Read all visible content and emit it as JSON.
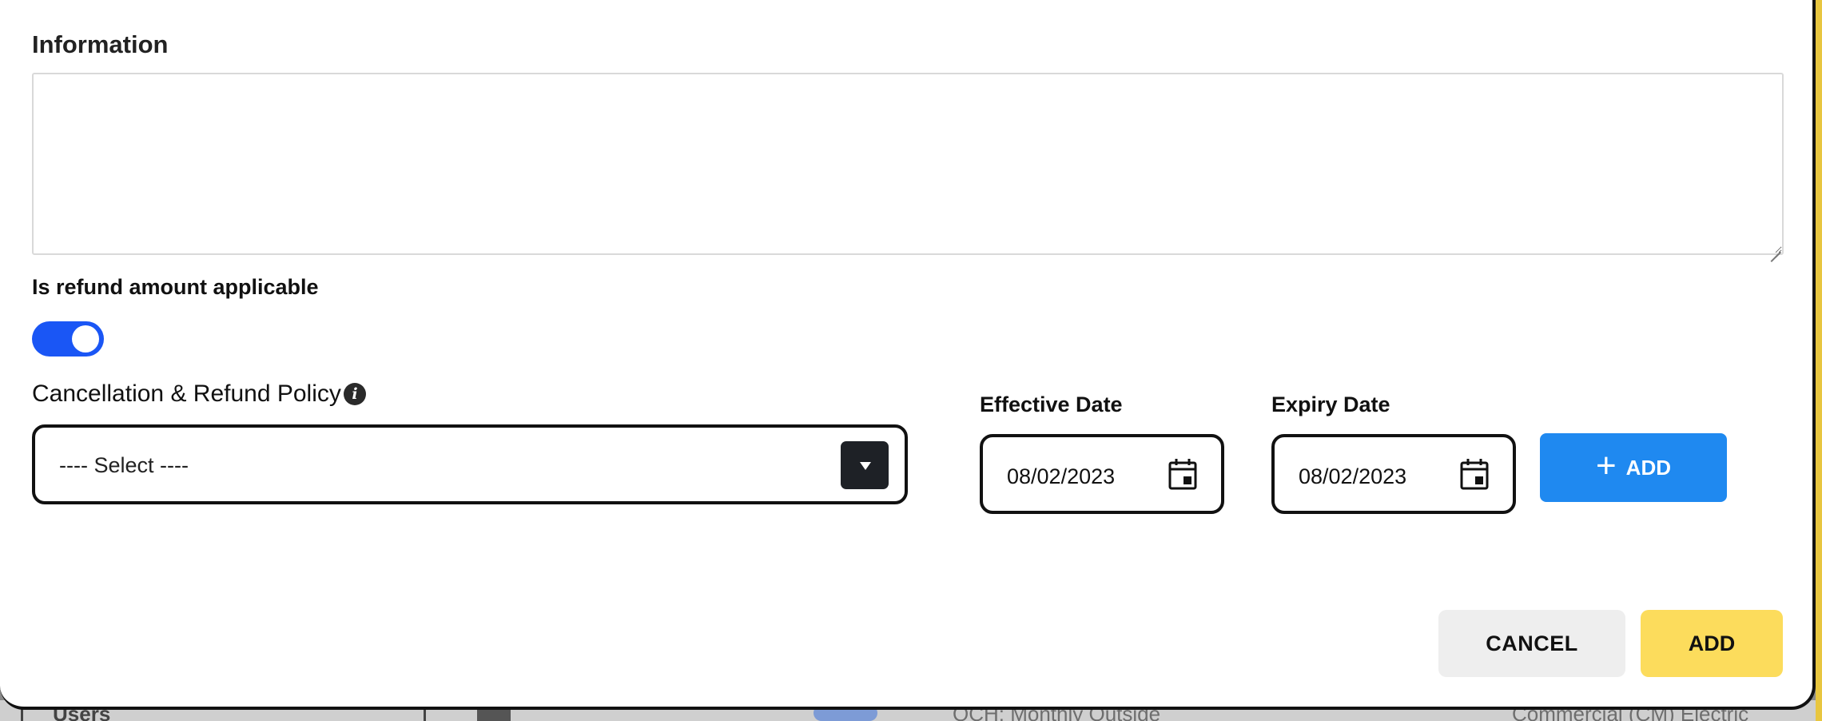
{
  "information": {
    "label": "Information",
    "value": ""
  },
  "refund": {
    "label": "Is refund amount applicable",
    "enabled": true
  },
  "policy": {
    "label": "Cancellation & Refund Policy",
    "info_icon": "info-circle-icon",
    "selected": "---- Select ----"
  },
  "effective_date": {
    "label": "Effective Date",
    "value": "08/02/2023",
    "icon": "calendar-icon"
  },
  "expiry_date": {
    "label": "Expiry Date",
    "value": "08/02/2023",
    "icon": "calendar-icon"
  },
  "add_row_button": {
    "label": "ADD",
    "icon": "plus-icon"
  },
  "footer": {
    "cancel_label": "CANCEL",
    "add_label": "ADD"
  },
  "background": {
    "left_text": "Users",
    "middle_text": "OCH: Monthly Outside",
    "right_text": "Commercial (CM) Electric"
  },
  "colors": {
    "toggle_on": "#1a56f5",
    "primary_button": "#1f89f0",
    "submit_button": "#fcdc5c",
    "cancel_button": "#eeeeee"
  }
}
